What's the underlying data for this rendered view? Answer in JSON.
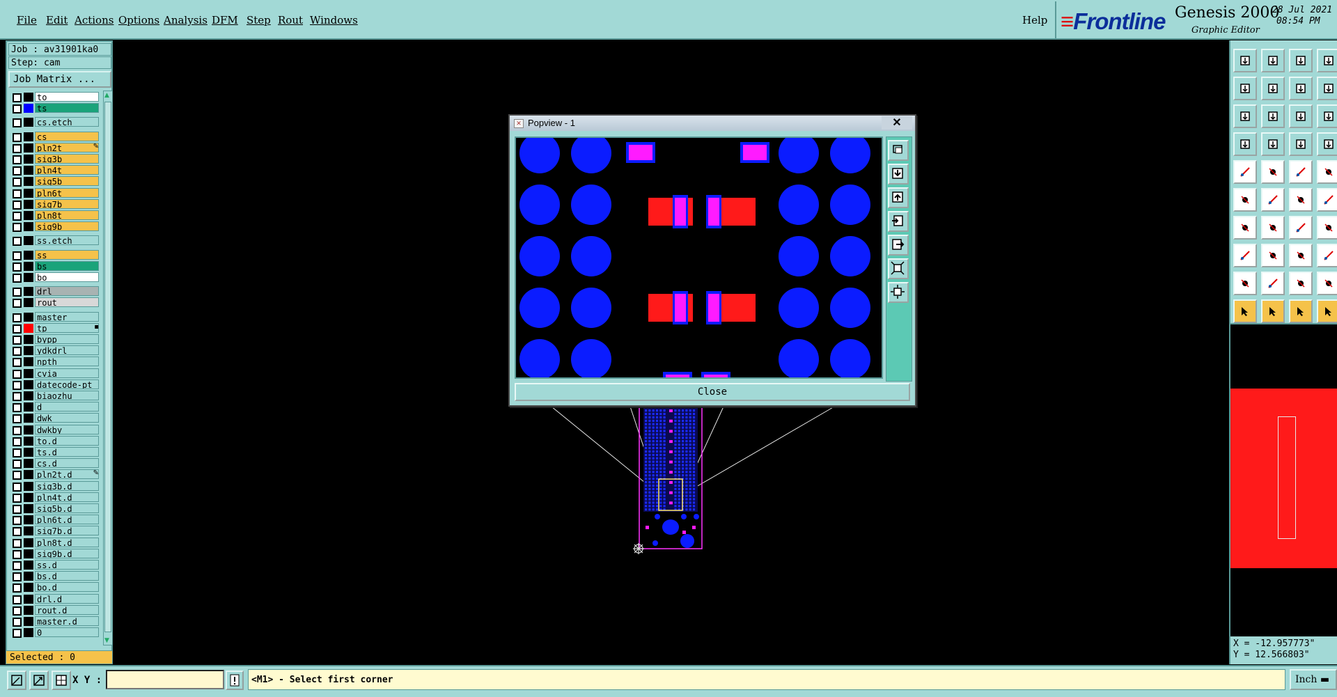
{
  "menu": [
    "File",
    "Edit",
    "Actions",
    "Options",
    "Analysis",
    "DFM",
    "Step",
    "Rout",
    "Windows"
  ],
  "help": "Help",
  "brand": {
    "logo": "Frontline",
    "product": "Genesis 2000",
    "subtitle": "Graphic Editor",
    "date": "28 Jul 2021",
    "time": "08:54 PM"
  },
  "job": {
    "name": "Job : av31901ka0",
    "step": "Step: cam",
    "matrix_button": "Job Matrix ..."
  },
  "layers": [
    {
      "name": "to",
      "color": "#ffffff",
      "swatch": "#000000"
    },
    {
      "name": "ts",
      "color": "#1aa37a",
      "swatch": "#0000ff"
    },
    {
      "name": "cs.etch",
      "color": "#a2d9d6",
      "swatch": "#000000",
      "gap": true
    },
    {
      "name": "cs",
      "color": "#f5c24a",
      "swatch": "#000000",
      "gap": true
    },
    {
      "name": "pln2t",
      "color": "#f5c24a",
      "swatch": "#000000",
      "mark": "✎"
    },
    {
      "name": "sig3b",
      "color": "#f5c24a",
      "swatch": "#000000"
    },
    {
      "name": "pln4t",
      "color": "#f5c24a",
      "swatch": "#000000"
    },
    {
      "name": "sig5b",
      "color": "#f5c24a",
      "swatch": "#000000"
    },
    {
      "name": "pln6t",
      "color": "#f5c24a",
      "swatch": "#000000"
    },
    {
      "name": "sig7b",
      "color": "#f5c24a",
      "swatch": "#000000"
    },
    {
      "name": "pln8t",
      "color": "#f5c24a",
      "swatch": "#000000"
    },
    {
      "name": "sig9b",
      "color": "#f5c24a",
      "swatch": "#000000"
    },
    {
      "name": "ss.etch",
      "color": "#a2d9d6",
      "swatch": "#000000",
      "gap": true
    },
    {
      "name": "ss",
      "color": "#f5c24a",
      "swatch": "#000000",
      "gap": true
    },
    {
      "name": "bs",
      "color": "#1aa37a",
      "swatch": "#000000"
    },
    {
      "name": "bo",
      "color": "#ffffff",
      "swatch": "#000000"
    },
    {
      "name": "drl",
      "color": "#a8b3b2",
      "swatch": "#000000",
      "gap": true
    },
    {
      "name": "rout",
      "color": "#d8d8d8",
      "swatch": "#000000"
    },
    {
      "name": "master",
      "color": "#a2d9d6",
      "swatch": "#000000",
      "gap": true
    },
    {
      "name": "tp",
      "color": "#a2d9d6",
      "swatch": "#ff0000",
      "mark": "▪"
    },
    {
      "name": "bypp",
      "color": "#a2d9d6",
      "swatch": "#000000"
    },
    {
      "name": "ydkdrl",
      "color": "#a2d9d6",
      "swatch": "#000000"
    },
    {
      "name": "npth",
      "color": "#a2d9d6",
      "swatch": "#000000"
    },
    {
      "name": "cvia",
      "color": "#a2d9d6",
      "swatch": "#000000"
    },
    {
      "name": "datecode-pt",
      "color": "#a2d9d6",
      "swatch": "#000000"
    },
    {
      "name": "biaozhu",
      "color": "#a2d9d6",
      "swatch": "#000000"
    },
    {
      "name": "d",
      "color": "#a2d9d6",
      "swatch": "#000000"
    },
    {
      "name": "dwk",
      "color": "#a2d9d6",
      "swatch": "#000000"
    },
    {
      "name": "dwkby",
      "color": "#a2d9d6",
      "swatch": "#000000"
    },
    {
      "name": "to.d",
      "color": "#a2d9d6",
      "swatch": "#000000"
    },
    {
      "name": "ts.d",
      "color": "#a2d9d6",
      "swatch": "#000000"
    },
    {
      "name": "cs.d",
      "color": "#a2d9d6",
      "swatch": "#000000"
    },
    {
      "name": "pln2t.d",
      "color": "#a2d9d6",
      "swatch": "#000000",
      "mark": "✎"
    },
    {
      "name": "sig3b.d",
      "color": "#a2d9d6",
      "swatch": "#000000"
    },
    {
      "name": "pln4t.d",
      "color": "#a2d9d6",
      "swatch": "#000000"
    },
    {
      "name": "sig5b.d",
      "color": "#a2d9d6",
      "swatch": "#000000"
    },
    {
      "name": "pln6t.d",
      "color": "#a2d9d6",
      "swatch": "#000000"
    },
    {
      "name": "sig7b.d",
      "color": "#a2d9d6",
      "swatch": "#000000"
    },
    {
      "name": "pln8t.d",
      "color": "#a2d9d6",
      "swatch": "#000000"
    },
    {
      "name": "sig9b.d",
      "color": "#a2d9d6",
      "swatch": "#000000"
    },
    {
      "name": "ss.d",
      "color": "#a2d9d6",
      "swatch": "#000000"
    },
    {
      "name": "bs.d",
      "color": "#a2d9d6",
      "swatch": "#000000"
    },
    {
      "name": "bo.d",
      "color": "#a2d9d6",
      "swatch": "#000000"
    },
    {
      "name": "drl.d",
      "color": "#a2d9d6",
      "swatch": "#000000"
    },
    {
      "name": "rout.d",
      "color": "#a2d9d6",
      "swatch": "#000000"
    },
    {
      "name": "master.d",
      "color": "#a2d9d6",
      "swatch": "#000000"
    },
    {
      "name": "0",
      "color": "#a2d9d6",
      "swatch": "#000000"
    }
  ],
  "selected": "Selected : 0",
  "bottom": {
    "xy_label": "X Y :",
    "xy_value": "",
    "prompt": "<M1> - Select first corner",
    "units": "Inch"
  },
  "coords": {
    "x": "X = -12.957773\"",
    "y": "Y = 12.566803\""
  },
  "popview": {
    "title": "Popview - 1",
    "close_x": "✕",
    "close_button": "Close"
  },
  "colors": {
    "panel": "#a2d9d6",
    "pad_blue": "#0b1cff",
    "pad_magenta": "#ff1bff",
    "pad_red": "#ff1a1a"
  },
  "icons": [
    "import-icon",
    "export-icon",
    "home-icon",
    "layout-icon",
    "left-in-icon",
    "right-in-icon",
    "zoom-fit-icon",
    "snap-icon",
    "fit-icon",
    "center-icon",
    "ratio-icon",
    "help-icon",
    "tree-icon",
    "probe-icon",
    "traffic-icon",
    "traffic2-icon",
    "measure-icon",
    "draw-line-icon",
    "ruler-icon",
    "dot-icon",
    "nodes-icon",
    "cross-icon",
    "connect-icon",
    "link-icon",
    "arc-icon",
    "slash-icon",
    "hook-icon",
    "flag-icon",
    "pin-icon",
    "minus-icon",
    "grid-icon",
    "box-icon",
    "triangle-icon",
    "triangle2-icon",
    "triangle3-icon",
    "triangle4-icon",
    "pointer-icon",
    "pointer2-icon",
    "pointer3-icon",
    "pointer4-icon"
  ]
}
